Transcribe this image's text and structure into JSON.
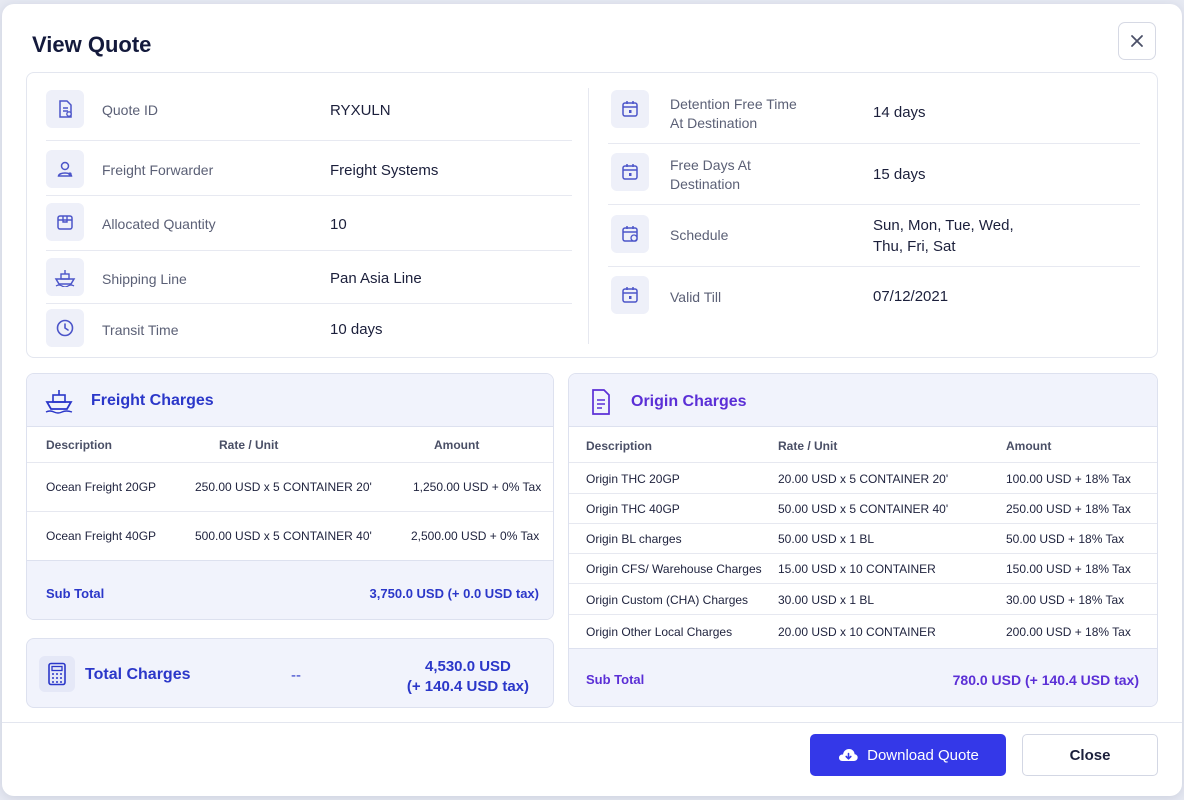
{
  "modal": {
    "title": "View Quote"
  },
  "quote_left": [
    {
      "icon": "document-icon",
      "label": "Quote ID",
      "value": "RYXULN"
    },
    {
      "icon": "user-icon",
      "label": "Freight Forwarder",
      "value": "Freight Systems"
    },
    {
      "icon": "box-icon",
      "label": "Allocated Quantity",
      "value": "10"
    },
    {
      "icon": "ship-icon",
      "label": "Shipping Line",
      "value": "Pan Asia Line"
    },
    {
      "icon": "clock-icon",
      "label": "Transit Time",
      "value": "10 days"
    }
  ],
  "quote_right": [
    {
      "icon": "calendar-icon",
      "label_line1": "Detention Free Time",
      "label_line2": "At Destination",
      "value_line1": "14 days",
      "value_line2": ""
    },
    {
      "icon": "calendar-icon",
      "label_line1": "Free Days At",
      "label_line2": "Destination",
      "value_line1": "15 days",
      "value_line2": ""
    },
    {
      "icon": "calendar-clock-icon",
      "label_line1": "Schedule",
      "label_line2": "",
      "value_line1": "Sun, Mon, Tue, Wed,",
      "value_line2": "Thu, Fri, Sat"
    },
    {
      "icon": "calendar-icon",
      "label_line1": "Valid Till",
      "label_line2": "",
      "value_line1": "07/12/2021",
      "value_line2": ""
    }
  ],
  "freight": {
    "title": "Freight Charges",
    "columns": [
      "Description",
      "Rate / Unit",
      "Amount"
    ],
    "rows": [
      [
        "Ocean Freight 20GP",
        "250.00 USD x 5 CONTAINER 20'",
        "1,250.00 USD + 0% Tax"
      ],
      [
        "Ocean Freight 40GP",
        "500.00 USD x 5 CONTAINER 40'",
        "2,500.00 USD + 0% Tax"
      ]
    ],
    "subtotal_label": "Sub Total",
    "subtotal_value": "3,750.0 USD (+ 0.0 USD tax)"
  },
  "origin": {
    "title": "Origin Charges",
    "columns": [
      "Description",
      "Rate / Unit",
      "Amount"
    ],
    "rows": [
      [
        "Origin THC 20GP",
        "20.00 USD x 5 CONTAINER 20'",
        "100.00 USD + 18% Tax"
      ],
      [
        "Origin THC 40GP",
        "50.00 USD x 5 CONTAINER 40'",
        "250.00 USD + 18% Tax"
      ],
      [
        "Origin BL charges",
        "50.00 USD x 1 BL",
        "50.00 USD + 18% Tax"
      ],
      [
        "Origin CFS/ Warehouse Charges",
        "15.00 USD x 10 CONTAINER",
        "150.00 USD + 18% Tax"
      ],
      [
        "Origin Custom (CHA) Charges",
        "30.00 USD x 1 BL",
        "30.00 USD + 18% Tax"
      ],
      [
        "Origin Other Local Charges",
        "20.00 USD x 10 CONTAINER",
        "200.00 USD + 18% Tax"
      ]
    ],
    "subtotal_label": "Sub Total",
    "subtotal_value": "780.0 USD (+ 140.4 USD tax)"
  },
  "total": {
    "label": "Total Charges",
    "middle": "--",
    "amount": "4,530.0 USD",
    "tax": "(+ 140.4 USD tax)"
  },
  "footer": {
    "download_label": "Download Quote",
    "close_label": "Close"
  },
  "colors": {
    "primary": "#3438e8",
    "freight_title": "#2b37c9",
    "origin_title": "#5b2fd6",
    "origin_subtotal": "#5b2fd6"
  }
}
